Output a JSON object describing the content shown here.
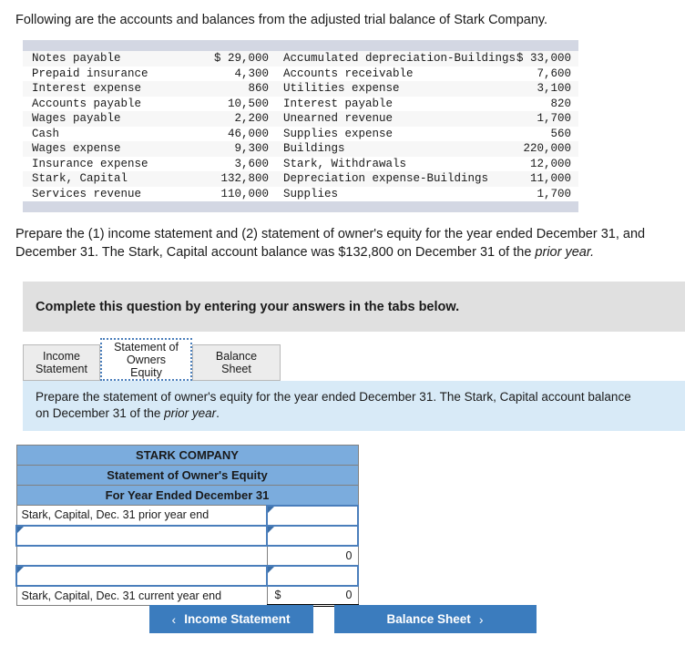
{
  "intro": "Following are the accounts and balances from the adjusted trial balance of Stark Company.",
  "trial_balance": {
    "left_column": [
      {
        "account": "Notes payable",
        "amount": "$ 29,000"
      },
      {
        "account": "Prepaid insurance",
        "amount": "4,300"
      },
      {
        "account": "Interest expense",
        "amount": "860"
      },
      {
        "account": "Accounts payable",
        "amount": "10,500"
      },
      {
        "account": "Wages payable",
        "amount": "2,200"
      },
      {
        "account": "Cash",
        "amount": "46,000"
      },
      {
        "account": "Wages expense",
        "amount": "9,300"
      },
      {
        "account": "Insurance expense",
        "amount": "3,600"
      },
      {
        "account": "Stark, Capital",
        "amount": "132,800"
      },
      {
        "account": "Services revenue",
        "amount": "110,000"
      }
    ],
    "right_column": [
      {
        "account": "Accumulated depreciation-Buildings",
        "amount": "$ 33,000"
      },
      {
        "account": "Accounts receivable",
        "amount": "7,600"
      },
      {
        "account": "Utilities expense",
        "amount": "3,100"
      },
      {
        "account": "Interest payable",
        "amount": "820"
      },
      {
        "account": "Unearned revenue",
        "amount": "1,700"
      },
      {
        "account": "Supplies expense",
        "amount": "560"
      },
      {
        "account": "Buildings",
        "amount": "220,000"
      },
      {
        "account": "Stark, Withdrawals",
        "amount": "12,000"
      },
      {
        "account": "Depreciation expense-Buildings",
        "amount": "11,000"
      },
      {
        "account": "Supplies",
        "amount": "1,700"
      }
    ]
  },
  "prepare": {
    "line1": "Prepare the (1) income statement and (2) statement of owner's equity for the year ended December 31, and",
    "line2_a": "December 31. The Stark, Capital account balance was $132,800 on December 31 of the ",
    "line2_italic": "prior year."
  },
  "banner": {
    "text": "Complete this question by entering your answers in the tabs below."
  },
  "tabs": [
    {
      "label": "Income Statement",
      "name": "tab-income-statement",
      "active": false
    },
    {
      "label": "Statement of Owners Equity",
      "name": "tab-statement-of-owners-equity",
      "active": true
    },
    {
      "label": "Balance Sheet",
      "name": "tab-balance-sheet",
      "active": false
    }
  ],
  "tab_labels": {
    "income_statement_l1": "Income",
    "income_statement_l2": "Statement",
    "owners_equity_l1": "Statement of",
    "owners_equity_l2": "Owners",
    "owners_equity_l3": "Equity",
    "balance_sheet": "Balance Sheet"
  },
  "blue_instruction": {
    "line1": "Prepare the statement of owner's equity for the year ended December 31. The Stark, Capital account balance",
    "line2_a": "on December 31 of the ",
    "line2_italic": "prior year",
    "line2_b": "."
  },
  "worksheet": {
    "header": {
      "company": "STARK COMPANY",
      "statement": "Statement of Owner's Equity",
      "period": "For Year Ended December 31"
    },
    "rows": [
      {
        "label": "Stark, Capital, Dec. 31 prior year end",
        "label_input": false,
        "amount": "",
        "amount_input": true,
        "dollar": "",
        "total": false
      },
      {
        "label": "",
        "label_input": true,
        "amount": "",
        "amount_input": true,
        "dollar": "",
        "total": false
      },
      {
        "label": "",
        "label_input": false,
        "amount": "0",
        "amount_input": false,
        "dollar": "",
        "total": false
      },
      {
        "label": "",
        "label_input": true,
        "amount": "",
        "amount_input": true,
        "dollar": "",
        "total": false
      },
      {
        "label": "Stark, Capital, Dec. 31 current year end",
        "label_input": false,
        "amount": "0",
        "amount_input": false,
        "dollar": "$",
        "total": true
      }
    ]
  },
  "nav": {
    "prev_label": "Income Statement",
    "prev_icon": "chevron-left",
    "next_label": "Balance Sheet",
    "next_icon": "chevron-right",
    "prev_chevron": "‹",
    "next_chevron": "›"
  },
  "colors": {
    "accent_blue": "#3b7cbe",
    "header_blue": "#7bacdd",
    "info_blue": "#d8eaf7",
    "banner_gray": "#e0e0e0",
    "panel_gray": "#d3d7e3",
    "input_border": "#4a7ebb"
  }
}
